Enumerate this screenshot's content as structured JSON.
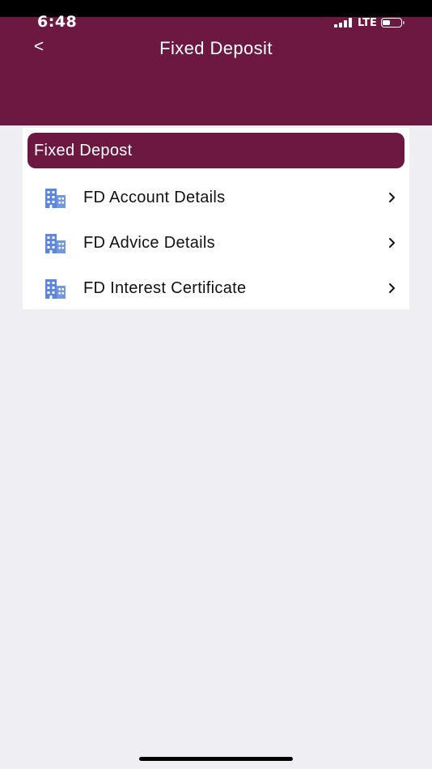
{
  "status_bar": {
    "time": "6:48",
    "network": "LTE",
    "signal_bars": 4,
    "battery_level": 0.45
  },
  "header": {
    "back_label": "<",
    "title": "Fixed Deposit"
  },
  "section": {
    "title": "Fixed Depost",
    "items": [
      {
        "label": "FD Account Details",
        "icon": "building-icon"
      },
      {
        "label": "FD Advice Details",
        "icon": "building-icon"
      },
      {
        "label": "FD Interest Certificate",
        "icon": "building-icon"
      }
    ]
  },
  "colors": {
    "brand": "#6d1841",
    "background": "#efeef3",
    "card": "#ffffff",
    "icon": "#5b86dd",
    "text": "#111111"
  }
}
